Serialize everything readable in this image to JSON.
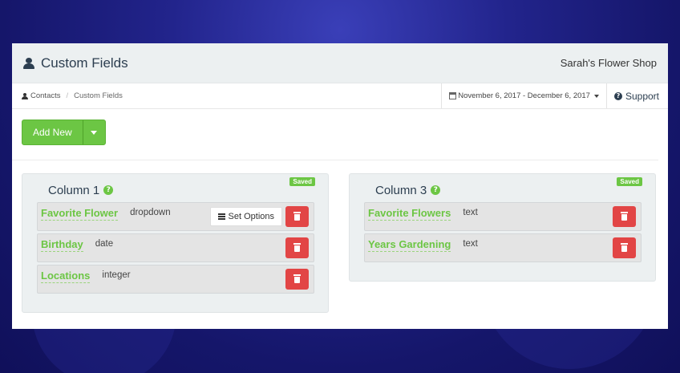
{
  "header": {
    "title": "Custom Fields",
    "shop_name": "Sarah's Flower Shop"
  },
  "breadcrumb": {
    "root": "Contacts",
    "separator": "/",
    "current": "Custom Fields"
  },
  "date_range": "November 6, 2017 - December 6, 2017",
  "support_label": "Support",
  "add_new_label": "Add New",
  "columns": [
    {
      "title": "Column 1",
      "badge": "Saved",
      "fields": [
        {
          "name": "Favorite Flower",
          "type": "dropdown",
          "action": "Set Options"
        },
        {
          "name": "Birthday",
          "type": "date"
        },
        {
          "name": "Locations",
          "type": "integer"
        }
      ]
    },
    {
      "title": "Column 3",
      "badge": "Saved",
      "fields": [
        {
          "name": "Favorite Flowers",
          "type": "text"
        },
        {
          "name": "Years Gardening",
          "type": "text"
        }
      ]
    }
  ],
  "colors": {
    "accent_green": "#6cc644",
    "danger_red": "#e24545",
    "header_bg": "#ecf0f1",
    "text_dark": "#2c3e50"
  }
}
